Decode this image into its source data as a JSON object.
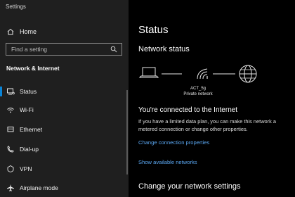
{
  "app": {
    "title": "Settings"
  },
  "sidebar": {
    "home_label": "Home",
    "search_placeholder": "Find a setting",
    "section_heading": "Network & Internet",
    "items": [
      {
        "label": "Status",
        "icon": "status-icon",
        "selected": true
      },
      {
        "label": "Wi-Fi",
        "icon": "wifi-icon"
      },
      {
        "label": "Ethernet",
        "icon": "ethernet-icon"
      },
      {
        "label": "Dial-up",
        "icon": "dialup-icon"
      },
      {
        "label": "VPN",
        "icon": "vpn-icon"
      },
      {
        "label": "Airplane mode",
        "icon": "airplane-icon"
      }
    ]
  },
  "main": {
    "title": "Status",
    "network_status_heading": "Network status",
    "network": {
      "name": "ACT_5g",
      "type": "Private network"
    },
    "connected_title": "You're connected to the Internet",
    "connected_desc": "If you have a limited data plan, you can make this network a metered connection or change other properties.",
    "change_properties_link": "Change connection properties",
    "show_networks_link": "Show available networks",
    "change_settings_heading": "Change your network settings"
  },
  "colors": {
    "sidebar_bg": "#1f1f1f",
    "main_bg": "#000000",
    "accent": "#0a84d6",
    "link": "#5aa6f0"
  }
}
